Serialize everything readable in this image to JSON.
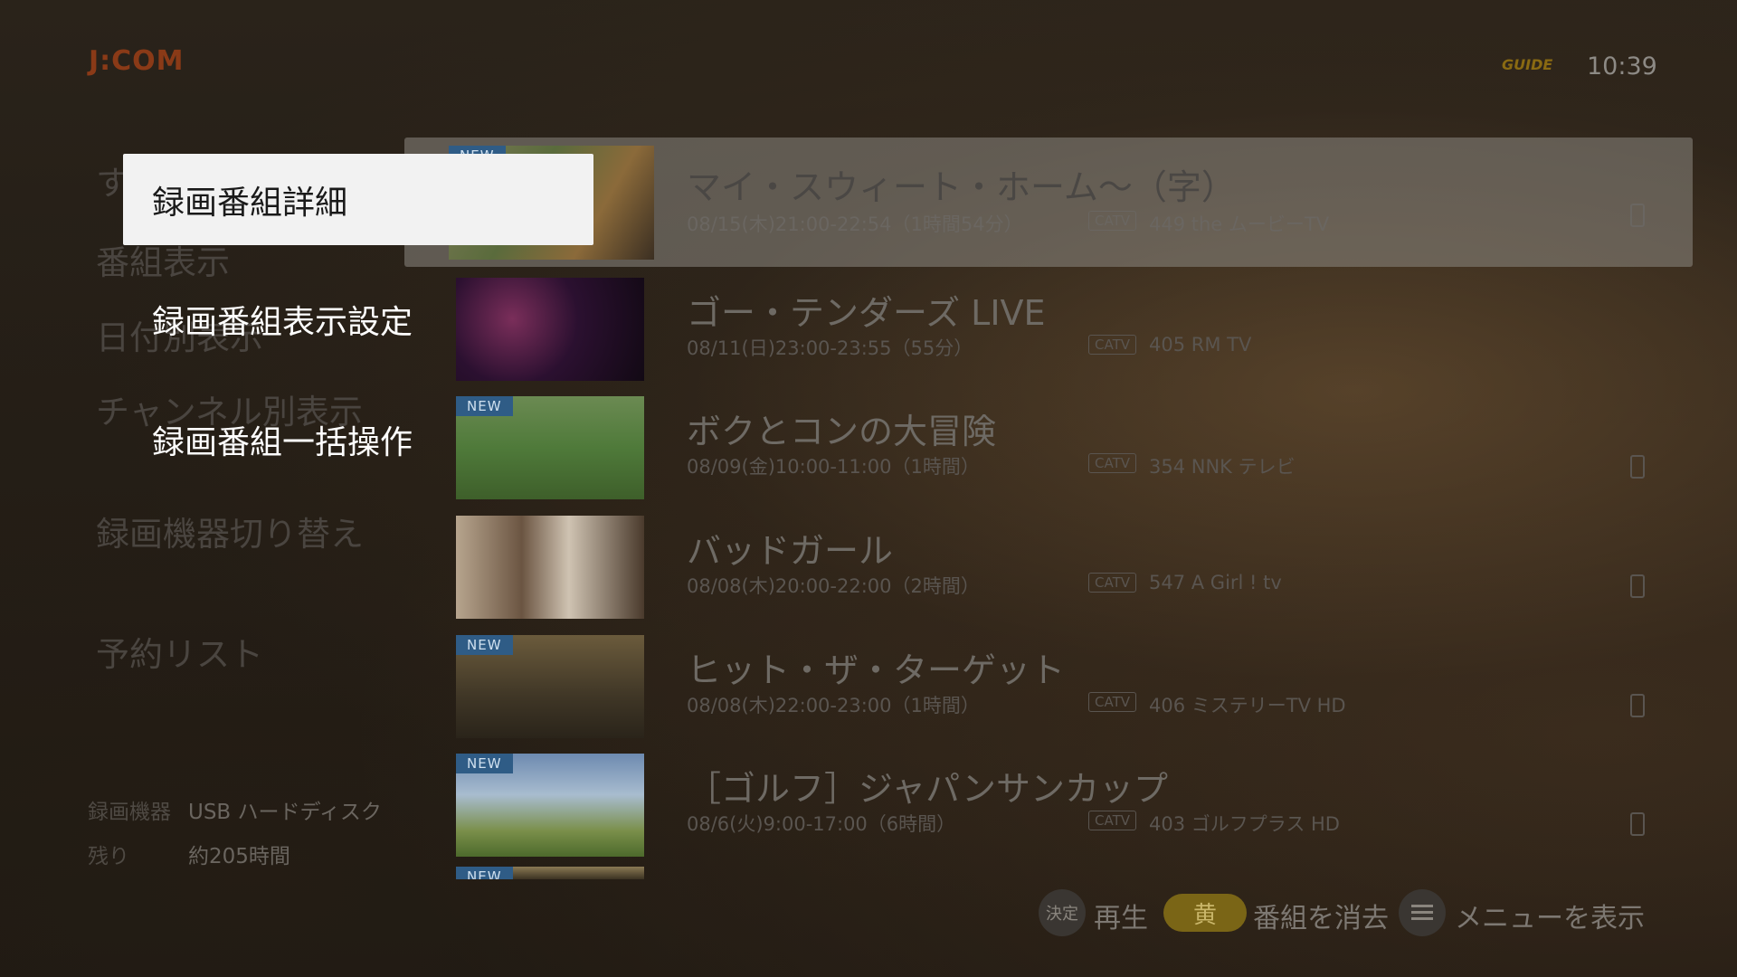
{
  "header": {
    "logo_text": "J:COM",
    "gguide_text": "GUIDE",
    "clock": "10:39"
  },
  "sidebar": {
    "items": [
      {
        "label": "す"
      },
      {
        "label": "番組表示"
      },
      {
        "label": "日付別表示"
      },
      {
        "label": "チャンネル別表示"
      },
      {
        "label": "録画機器切り替え"
      },
      {
        "label": "予約リスト"
      }
    ],
    "device_label": "録画機器",
    "device_value": "USB ハードディスク",
    "remaining_label": "残り",
    "remaining_value": "約205時間"
  },
  "popup_menu": {
    "items": [
      {
        "label": "録画番組詳細",
        "focused": true
      },
      {
        "label": "録画番組表示設定",
        "focused": false
      },
      {
        "label": "録画番組一括操作",
        "focused": false
      }
    ]
  },
  "recordings": [
    {
      "new": "NEW",
      "title": "マイ・スウィート・ホーム〜（字）",
      "datetime": "08/15(木)21:00-22:54（1時間54分）",
      "source": "CATV",
      "channel": "449 the ムービーTV"
    },
    {
      "new": "",
      "title": "ゴー・テンダーズ LIVE",
      "datetime": "08/11(日)23:00-23:55（55分）",
      "source": "CATV",
      "channel": "405  RM TV"
    },
    {
      "new": "NEW",
      "title": "ボクとコンの大冒険",
      "datetime": "08/09(金)10:00-11:00（1時間）",
      "source": "CATV",
      "channel": "354  NNK テレビ"
    },
    {
      "new": "",
      "title": "バッドガール",
      "datetime": "08/08(木)20:00-22:00（2時間）",
      "source": "CATV",
      "channel": "547  A Girl ! tv"
    },
    {
      "new": "NEW",
      "title": "ヒット・ザ・ターゲット",
      "datetime": "08/08(木)22:00-23:00（1時間）",
      "source": "CATV",
      "channel": "406  ミステリーTV HD"
    },
    {
      "new": "NEW",
      "title": "［ゴルフ］ジャパンサンカップ",
      "datetime": "08/6(火)9:00-17:00（6時間）",
      "source": "CATV",
      "channel": "403  ゴルフプラス HD"
    },
    {
      "new": "NEW",
      "title": "",
      "datetime": "",
      "source": "",
      "channel": ""
    }
  ],
  "footer": {
    "ok_key": "決定",
    "ok_label": "再生",
    "yellow_key": "黄",
    "yellow_label": "番組を消去",
    "menu_label": "メニューを表示"
  }
}
